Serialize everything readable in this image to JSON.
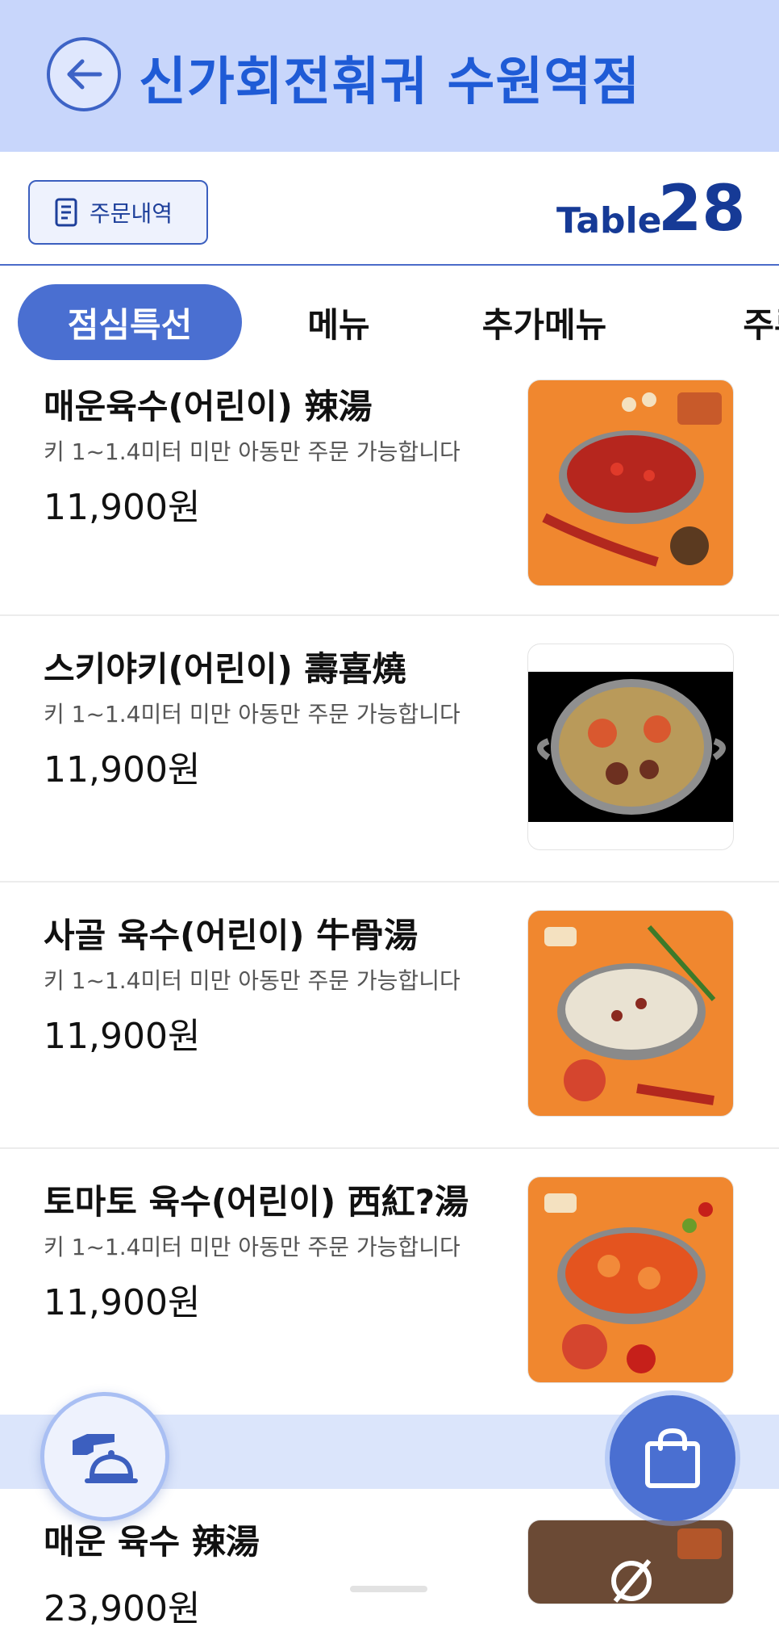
{
  "header": {
    "title": "신가회전훠궈 수원역점",
    "back_icon": "back-arrow-icon"
  },
  "toolbar": {
    "order_history_label": "주문내역",
    "table_label": "Table",
    "table_number": "28"
  },
  "tabs": [
    {
      "label": "점심특선",
      "active": true
    },
    {
      "label": "메뉴",
      "active": false
    },
    {
      "label": "추가메뉴",
      "active": false
    },
    {
      "label": "주류",
      "active": false
    }
  ],
  "menu_items": [
    {
      "name": "매운육수(어린이) 辣湯",
      "desc": "키 1~1.4미터 미만 아동만 주문 가능합니다",
      "price": "11,900원",
      "image": "spicy-broth-pot"
    },
    {
      "name": "스키야키(어린이) 壽喜燒",
      "desc": "키 1~1.4미터 미만 아동만 주문 가능합니다",
      "price": "11,900원",
      "image": "sukiyaki-pot"
    },
    {
      "name": "사골 육수(어린이) 牛骨湯",
      "desc": "키 1~1.4미터 미만 아동만 주문 가능합니다",
      "price": "11,900원",
      "image": "bone-broth-pot"
    },
    {
      "name": "토마토 육수(어린이) 西紅?湯",
      "desc": "키 1~1.4미터 미만 아동만 주문 가능합니다",
      "price": "11,900원",
      "image": "tomato-broth-pot"
    },
    {
      "name": "매운 육수 辣湯",
      "desc": "",
      "price": "23,900원",
      "image": "spicy-broth-pot"
    }
  ],
  "colors": {
    "header_bg": "#c8d6fb",
    "accent": "#4a6fd1",
    "title": "#1f5bd6"
  },
  "fab": {
    "call_staff_icon": "service-bell-icon",
    "cart_icon": "shopping-bag-icon"
  }
}
